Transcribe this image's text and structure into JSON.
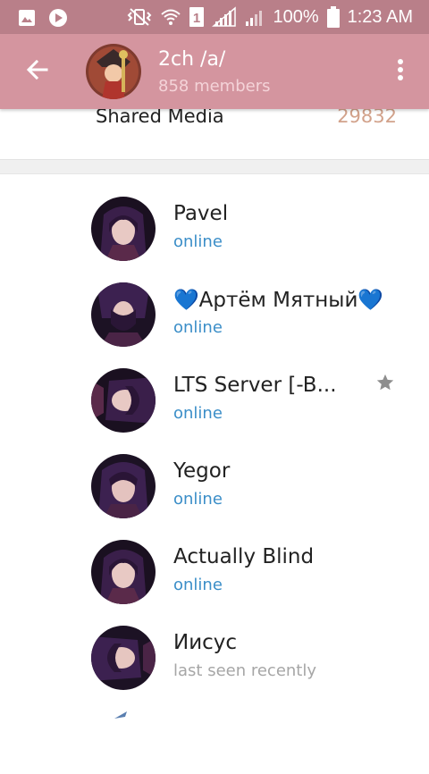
{
  "status_bar": {
    "battery_percent": "100%",
    "time": "1:23 AM",
    "sim_number": "1",
    "icons": [
      "image-icon",
      "play-icon",
      "vibrate-icon",
      "wifi-icon",
      "sim-icon",
      "signal-icon",
      "signal-icon-2"
    ]
  },
  "header": {
    "title": "2ch /a/",
    "subtitle": "858 members",
    "back_icon": "arrow-left-icon",
    "menu_icon": "more-vertical-icon"
  },
  "shared_media": {
    "label": "Shared Media",
    "count": "29832"
  },
  "members": [
    {
      "name": "Pavel",
      "status": "online",
      "online": true,
      "starred": false
    },
    {
      "name": "💙Артём Мятный💙",
      "status": "online",
      "online": true,
      "starred": false
    },
    {
      "name": "LTS Server [-B...",
      "status": "online",
      "online": true,
      "starred": true
    },
    {
      "name": "Yegor",
      "status": "online",
      "online": true,
      "starred": false
    },
    {
      "name": "Actually Blind",
      "status": "online",
      "online": true,
      "starred": false
    },
    {
      "name": "Иисус",
      "status": "last seen recently",
      "online": false,
      "starred": false
    }
  ],
  "colors": {
    "status_bar": "#b97f89",
    "app_bar": "#d4959f",
    "online": "#3b8ec8",
    "offline": "#a6a6a6",
    "shared_count": "#d2a28b"
  }
}
